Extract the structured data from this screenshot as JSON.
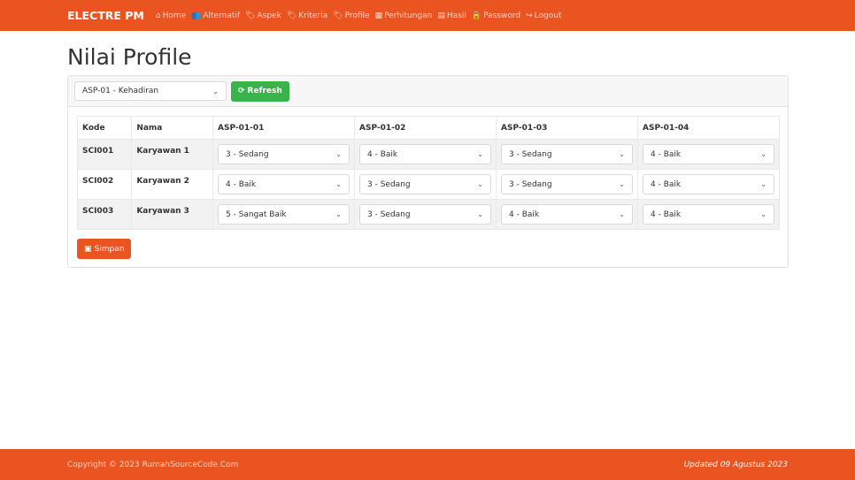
{
  "nav": {
    "brand": "ELECTRE PM",
    "items": [
      {
        "label": "Home",
        "icon": "home-icon",
        "glyph": "⌂"
      },
      {
        "label": "Alternatif",
        "icon": "users-icon",
        "glyph": "👥"
      },
      {
        "label": "Aspek",
        "icon": "tag-icon",
        "glyph": "🏷"
      },
      {
        "label": "Kriteria",
        "icon": "tags-icon",
        "glyph": "🏷"
      },
      {
        "label": "Profile",
        "icon": "tags-icon",
        "glyph": "🏷"
      },
      {
        "label": "Perhitungan",
        "icon": "calculator-icon",
        "glyph": "▦"
      },
      {
        "label": "Hasil",
        "icon": "calendar-icon",
        "glyph": "▤"
      },
      {
        "label": "Password",
        "icon": "lock-icon",
        "glyph": "🔒"
      },
      {
        "label": "Logout",
        "icon": "sign-out-icon",
        "glyph": "↪"
      }
    ]
  },
  "page": {
    "title": "Nilai Profile"
  },
  "filter": {
    "aspect_selected": "ASP-01 - Kehadiran",
    "refresh_label": "Refresh"
  },
  "table": {
    "headers": [
      "Kode",
      "Nama",
      "ASP-01-01",
      "ASP-01-02",
      "ASP-01-03",
      "ASP-01-04"
    ],
    "rows": [
      {
        "kode": "SCI001",
        "nama": "Karyawan 1",
        "values": [
          "3 - Sedang",
          "4 - Baik",
          "3 - Sedang",
          "4 - Baik"
        ]
      },
      {
        "kode": "SCI002",
        "nama": "Karyawan 2",
        "values": [
          "4 - Baik",
          "3 - Sedang",
          "3 - Sedang",
          "4 - Baik"
        ]
      },
      {
        "kode": "SCI003",
        "nama": "Karyawan 3",
        "values": [
          "5 - Sangat Baik",
          "3 - Sedang",
          "4 - Baik",
          "4 - Baik"
        ]
      }
    ]
  },
  "actions": {
    "save_label": "Simpan"
  },
  "footer": {
    "copyright": "Copyright © 2023 RumahSourceCode.Com",
    "updated": "Updated 09 Agustus 2023"
  },
  "colors": {
    "primary": "#e95420",
    "success": "#38b44a"
  }
}
